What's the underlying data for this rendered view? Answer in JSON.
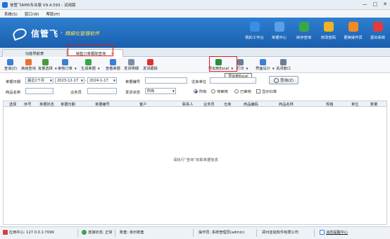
{
  "window": {
    "title": "信管飞RMS专业版 V9.4.593 - 试用版",
    "min": "—",
    "max": "□",
    "close": "✕"
  },
  "menu": [
    "系统(S)",
    "窗口(W)",
    "帮助(H)"
  ],
  "brand": {
    "name": "信管飞",
    "slogan": "精细化管理软件",
    "accent": "#ffe65c"
  },
  "nav": [
    {
      "label": "我的工作台",
      "icon": "monitor-icon",
      "color": "#3a8ee6"
    },
    {
      "label": "单据中心",
      "icon": "document-icon",
      "color": "#5aa0e8"
    },
    {
      "label": "库存查询",
      "icon": "chart-icon",
      "color": "#36a84a"
    },
    {
      "label": "修改密码",
      "icon": "lock-icon",
      "color": "#f0b321"
    },
    {
      "label": "更换操作员",
      "icon": "user-icon",
      "color": "#f08a24"
    },
    {
      "label": "退出系统",
      "icon": "exit-icon",
      "color": "#e23b3b"
    }
  ],
  "tabs": [
    {
      "label": "功能导航表"
    },
    {
      "label": "销售订单跟踪查询",
      "close": "×"
    }
  ],
  "toolbar": [
    {
      "label": "查询(Z)",
      "icon": "query-icon",
      "color": "#3b7fd6"
    },
    {
      "label": "高级查询",
      "icon": "advanced-query-icon",
      "color": "#e8732a"
    },
    {
      "label": "批量选择",
      "icon": "batch-select-icon",
      "color": "#4a9a3a"
    },
    {
      "label": "审核订单",
      "icon": "audit-icon",
      "color": "#3b7fd6"
    },
    {
      "label": "生成单据",
      "icon": "generate-icon",
      "color": "#36a84a"
    },
    {
      "label": "查看单据",
      "icon": "view-doc-icon",
      "color": "#3b7fd6"
    },
    {
      "label": "发货明细",
      "icon": "delivery-detail-icon",
      "color": "#7a8ea8"
    },
    {
      "label": "发货跟踪",
      "icon": "delivery-track-icon",
      "color": "#d33"
    },
    {
      "label": "导出到Excel",
      "icon": "excel-icon",
      "color": "#2e8b3e"
    },
    {
      "label": "打印",
      "icon": "print-icon",
      "color": "#6a7f98"
    },
    {
      "label": "界面设计",
      "icon": "design-icon",
      "color": "#3b7fd6"
    },
    {
      "label": "关闭窗口",
      "icon": "close-window-icon",
      "color": "#6a7f98"
    }
  ],
  "tooltip": "导出到Excel",
  "filter": {
    "date_label": "单据日期",
    "date_range": "最近1个月",
    "date_from": "2023-12-17",
    "date_to": "2024-1-17",
    "doc_no_label": "单据编号",
    "doc_no": "",
    "partner_label": "往来单位",
    "partner": "",
    "product_label": "商品名称",
    "product": "",
    "staff_label": "业务员",
    "staff": "",
    "ship_label": "发货状态",
    "ship_status": "所有",
    "audit": [
      "所有",
      "待审核",
      "已审核"
    ],
    "show_red": "显示红单",
    "query_button": "查询(Z)"
  },
  "columns": [
    "选择",
    "序号",
    "单据状态",
    "单据日期",
    "单据编号",
    "客户",
    "联系人",
    "业务员",
    "仓库",
    "商品编码",
    "商品名称",
    "规格",
    "单位",
    "数量"
  ],
  "empty_message": "请执行“查询”获取单据信息",
  "status": {
    "app_center": "应用中心: 127.0.0.1:7099",
    "conn": "连接状态: 正常",
    "account": "账套: 演示账套",
    "operator": "操作员: 系统管理员(admin)",
    "company": "郑州亚铭软件有限公司",
    "message": "消息提醒中心"
  }
}
